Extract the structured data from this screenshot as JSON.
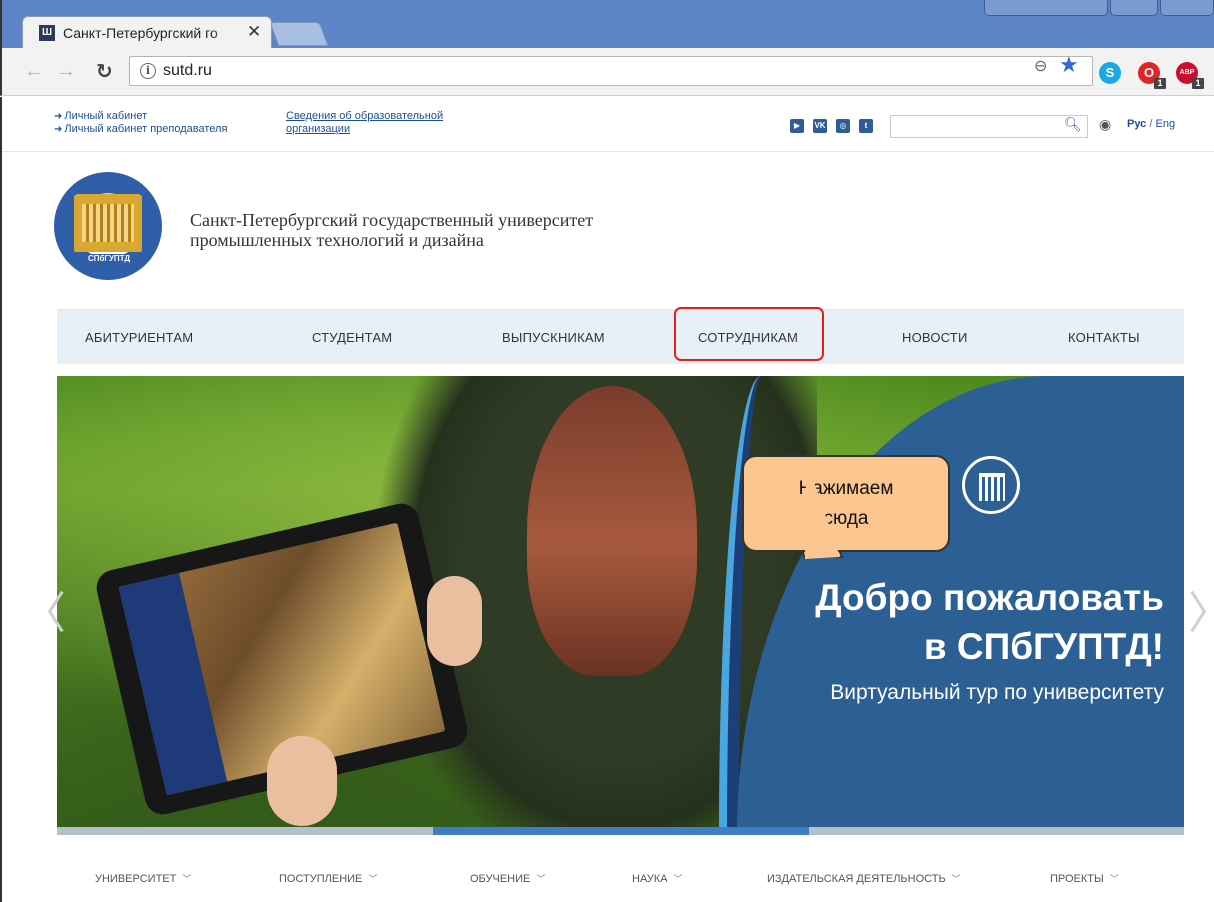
{
  "browser": {
    "tab_title": "Санкт-Петербургский го",
    "favicon": "СПбГУПТД",
    "tab_close": "✕",
    "url": "sutd.ru",
    "ext_skype": "S",
    "ext_opera": "O",
    "ext_opera_badge": "1",
    "ext_abp": "ABP",
    "ext_abp_badge": "1"
  },
  "topbar": {
    "cabinet_label": "Личный кабинет",
    "teacher_cabinet_label": "Личный кабинет преподавателя",
    "svedenia_link": "Сведения об образовательной организации",
    "social": [
      "▶",
      "VK",
      "◎",
      "t"
    ],
    "search_placeholder": "",
    "lang_ru": "Рус",
    "lang_sep": " / ",
    "lang_en": "Eng"
  },
  "header": {
    "logo_text": "СПбГУПТД",
    "uni_name_line1": "Санкт-Петербургский государственный университет",
    "uni_name_line2": "промышленных технологий и дизайна"
  },
  "main_nav": [
    "АБИТУРИЕНТАМ",
    "СТУДЕНТАМ",
    "ВЫПУСКНИКАМ",
    "СОТРУДНИКАМ",
    "НОВОСТИ",
    "КОНТАКТЫ"
  ],
  "slider": {
    "welcome_line1": "Добро пожаловать",
    "welcome_line2": "в СПбГУПТД!",
    "tour_text": "Виртуальный тур по университету",
    "prev_arrow": "〈",
    "next_arrow": "〉",
    "progress_active_segment": 2,
    "progress_segments": 3
  },
  "sub_nav": [
    "УНИВЕРСИТЕТ",
    "ПОСТУПЛЕНИЕ",
    "ОБУЧЕНИЕ",
    "НАУКА",
    "ИЗДАТЕЛЬСКАЯ ДЕЯТЕЛЬНОСТЬ",
    "ПРОЕКТЫ"
  ],
  "annotation": {
    "line1": "Нажимаем",
    "line2": "сюда",
    "highlight_color": "#e0201a",
    "callout_color": "#fbc690"
  },
  "colors": {
    "chrome_blue": "#5d84c6",
    "link_blue": "#1d4f94",
    "nav_bg": "#e8f0f7",
    "slider_panel": "#2c5f93"
  }
}
